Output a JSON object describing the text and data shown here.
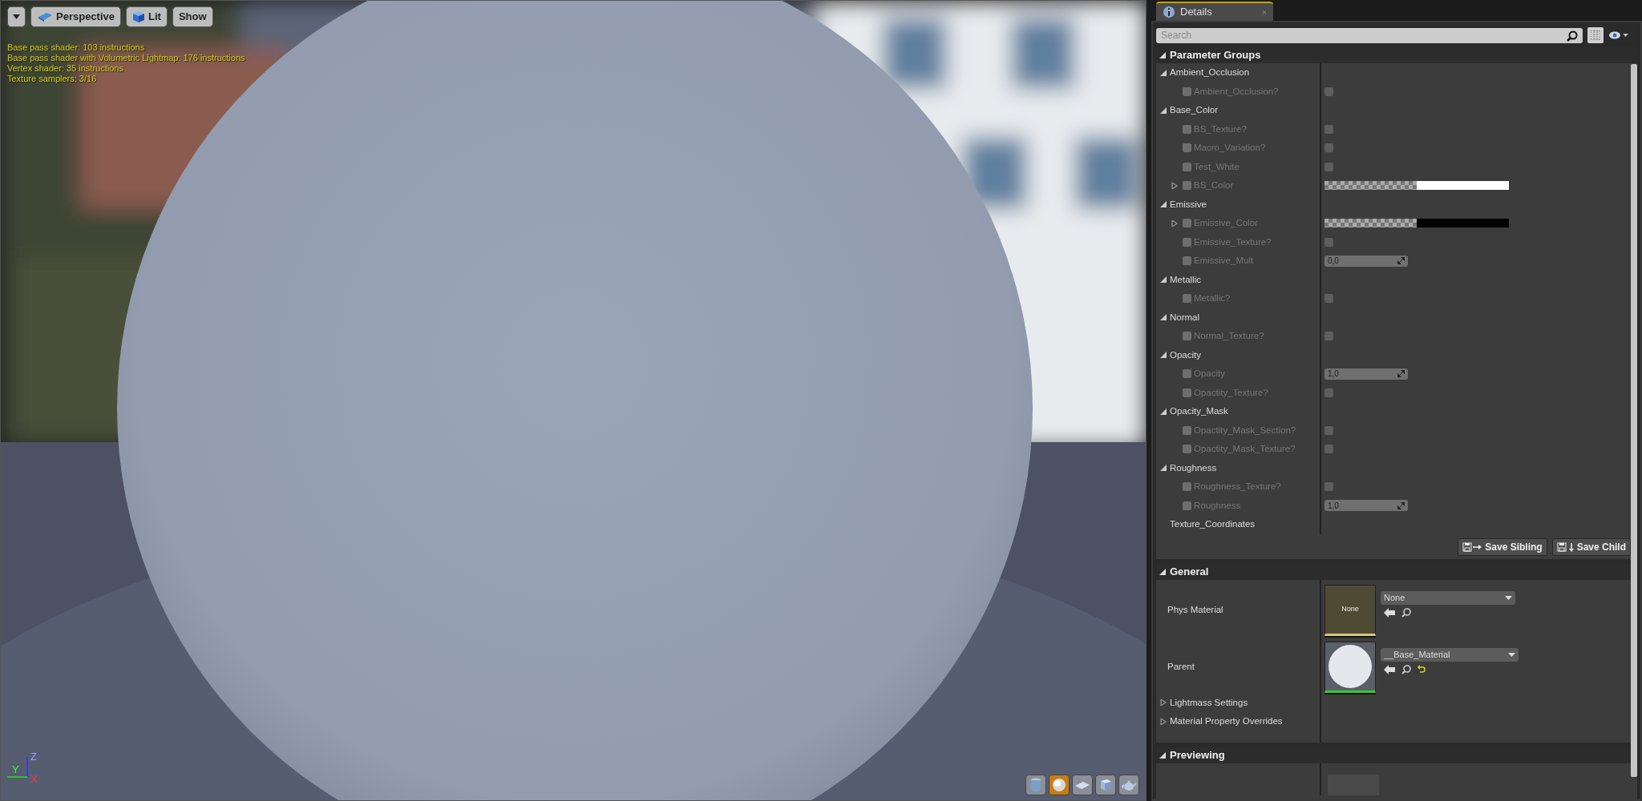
{
  "viewport": {
    "toolbar": [
      {
        "kind": "menu"
      },
      {
        "kind": "view",
        "label": "Perspective"
      },
      {
        "kind": "mode",
        "label": "Lit"
      },
      {
        "kind": "plain",
        "label": "Show"
      }
    ],
    "stats": [
      "Base pass shader: 103 instructions",
      "Base pass shader with Volumetric Lightmap: 176 instructions",
      "Vertex shader: 35 instructions",
      "Texture samplers: 3/16"
    ],
    "axes": {
      "z": "Z",
      "y": "Y",
      "x": "X"
    },
    "preview_shapes": [
      {
        "kind": "cylinder",
        "selected": false
      },
      {
        "kind": "sphere",
        "selected": true
      },
      {
        "kind": "plane",
        "selected": false
      },
      {
        "kind": "cube",
        "selected": false
      },
      {
        "kind": "teapot",
        "selected": false
      }
    ]
  },
  "details": {
    "tab": {
      "title": "Details",
      "close": "×"
    },
    "search": {
      "placeholder": "Search"
    },
    "parameter_groups": {
      "title": "Parameter Groups",
      "expanded": true,
      "groups": [
        {
          "kind": "group",
          "name": "Ambient_Occlusion",
          "expanded": true,
          "params": [
            {
              "kind": "checkbox",
              "name": "Ambient_Occlusion?",
              "overridden": false,
              "checked": false
            }
          ]
        },
        {
          "kind": "group",
          "name": "Base_Color",
          "expanded": true,
          "params": [
            {
              "kind": "checkbox",
              "name": "BS_Texture?",
              "overridden": false,
              "checked": false
            },
            {
              "kind": "checkbox",
              "name": "Macro_Variation?",
              "overridden": false,
              "checked": false
            },
            {
              "kind": "checkbox",
              "name": "Test_White",
              "overridden": false,
              "checked": false
            },
            {
              "kind": "color",
              "name": "BS_Color",
              "overridden": false,
              "expanded": false,
              "color": "#ffffff"
            }
          ]
        },
        {
          "kind": "group",
          "name": "Emissive",
          "expanded": true,
          "params": [
            {
              "kind": "color",
              "name": "Emissive_Color",
              "overridden": false,
              "expanded": false,
              "color": "#000000"
            },
            {
              "kind": "checkbox",
              "name": "Emissive_Texture?",
              "overridden": false,
              "checked": false
            },
            {
              "kind": "number",
              "name": "Emissive_Mult",
              "overridden": false,
              "value": "0,0"
            }
          ]
        },
        {
          "kind": "group",
          "name": "Metallic",
          "expanded": true,
          "params": [
            {
              "kind": "checkbox",
              "name": "Metallic?",
              "overridden": false,
              "checked": false
            }
          ]
        },
        {
          "kind": "group",
          "name": "Normal",
          "expanded": true,
          "params": [
            {
              "kind": "checkbox",
              "name": "Normal_Texture?",
              "overridden": false,
              "checked": false
            }
          ]
        },
        {
          "kind": "group",
          "name": "Opacity",
          "expanded": true,
          "params": [
            {
              "kind": "number",
              "name": "Opacity",
              "overridden": false,
              "value": "1,0"
            },
            {
              "kind": "checkbox",
              "name": "Opactity_Texture?",
              "overridden": false,
              "checked": false
            }
          ]
        },
        {
          "kind": "group",
          "name": "Opacity_Mask",
          "expanded": true,
          "params": [
            {
              "kind": "checkbox",
              "name": "Opactity_Mask_Section?",
              "overridden": false,
              "checked": false
            },
            {
              "kind": "checkbox",
              "name": "Opactity_Mask_Texture?",
              "overridden": false,
              "checked": false
            }
          ]
        },
        {
          "kind": "group",
          "name": "Roughness",
          "expanded": true,
          "params": [
            {
              "kind": "checkbox",
              "name": "Roughness_Texture?",
              "overridden": false,
              "checked": false
            },
            {
              "kind": "number",
              "name": "Roughness",
              "overridden": false,
              "value": "1,0"
            }
          ]
        },
        {
          "kind": "label",
          "name": "Texture_Coordinates"
        }
      ],
      "buttons": [
        {
          "kind": "sibling",
          "label": "Save Sibling"
        },
        {
          "kind": "child",
          "label": "Save Child"
        }
      ]
    },
    "general": {
      "title": "General",
      "expanded": true,
      "assets": [
        {
          "label": "Phys Material",
          "kind": "empty",
          "thumb_text": "None",
          "value": "None",
          "reset": false
        },
        {
          "label": "Parent",
          "kind": "sphere",
          "value": "__Base_Material",
          "reset": true
        }
      ],
      "subsections": [
        {
          "label": "Lightmass Settings",
          "expanded": false
        },
        {
          "label": "Material Property Overrides",
          "expanded": false
        }
      ]
    },
    "previewing": {
      "title": "Previewing",
      "expanded": true
    }
  }
}
